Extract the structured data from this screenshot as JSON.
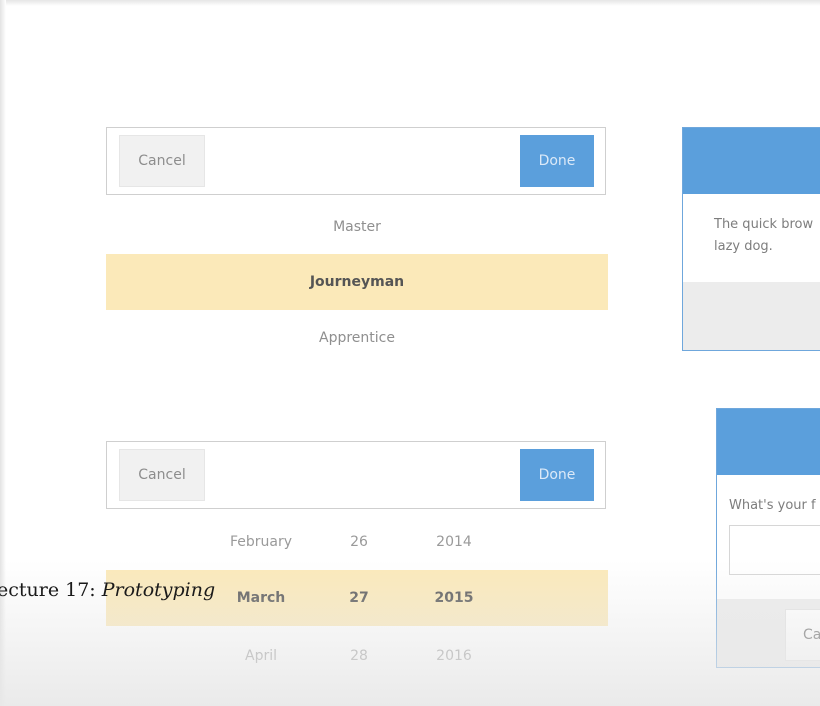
{
  "picker1": {
    "cancel_label": "Cancel",
    "done_label": "Done",
    "options": [
      {
        "label": "Master",
        "selected": false
      },
      {
        "label": "Journeyman",
        "selected": true
      },
      {
        "label": "Apprentice",
        "selected": false
      }
    ]
  },
  "picker2": {
    "cancel_label": "Cancel",
    "done_label": "Done",
    "rows": [
      {
        "month": "February",
        "day": "26",
        "year": "2014",
        "selected": false
      },
      {
        "month": "March",
        "day": "27",
        "year": "2015",
        "selected": true
      },
      {
        "month": "April",
        "day": "28",
        "year": "2016",
        "selected": false
      }
    ]
  },
  "alert_dialog": {
    "body_line1": "The quick brow",
    "body_line2": "lazy dog."
  },
  "prompt_dialog": {
    "question": "What's your f",
    "input_value": "",
    "cancel_label": "Ca"
  },
  "caption": {
    "prefix": "ecture 17: ",
    "emphasis": "Prototyping"
  },
  "colors": {
    "accent_blue": "#5b9fdc",
    "selection_highlight": "#fbe9b9",
    "dialog_border": "#6fa7dc"
  }
}
